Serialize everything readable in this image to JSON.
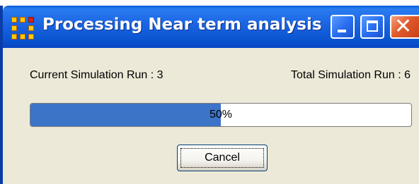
{
  "window": {
    "title": "Processing Near term analysis",
    "icon": "network-nodes-icon",
    "controls": [
      "minimize-icon",
      "maximize-icon",
      "close-icon"
    ]
  },
  "status": {
    "current_run_label": "Current Simulation Run : 3",
    "total_run_label": "Total Simulation Run : 6"
  },
  "progress": {
    "value": 0.5,
    "text": "50%"
  },
  "buttons": {
    "cancel_label": "Cancel"
  },
  "colors": {
    "titlebar": "#0a55d0",
    "window_bg": "#ece9d8",
    "progress_fill": "#3c74c8",
    "close_button": "#e05a2a"
  }
}
